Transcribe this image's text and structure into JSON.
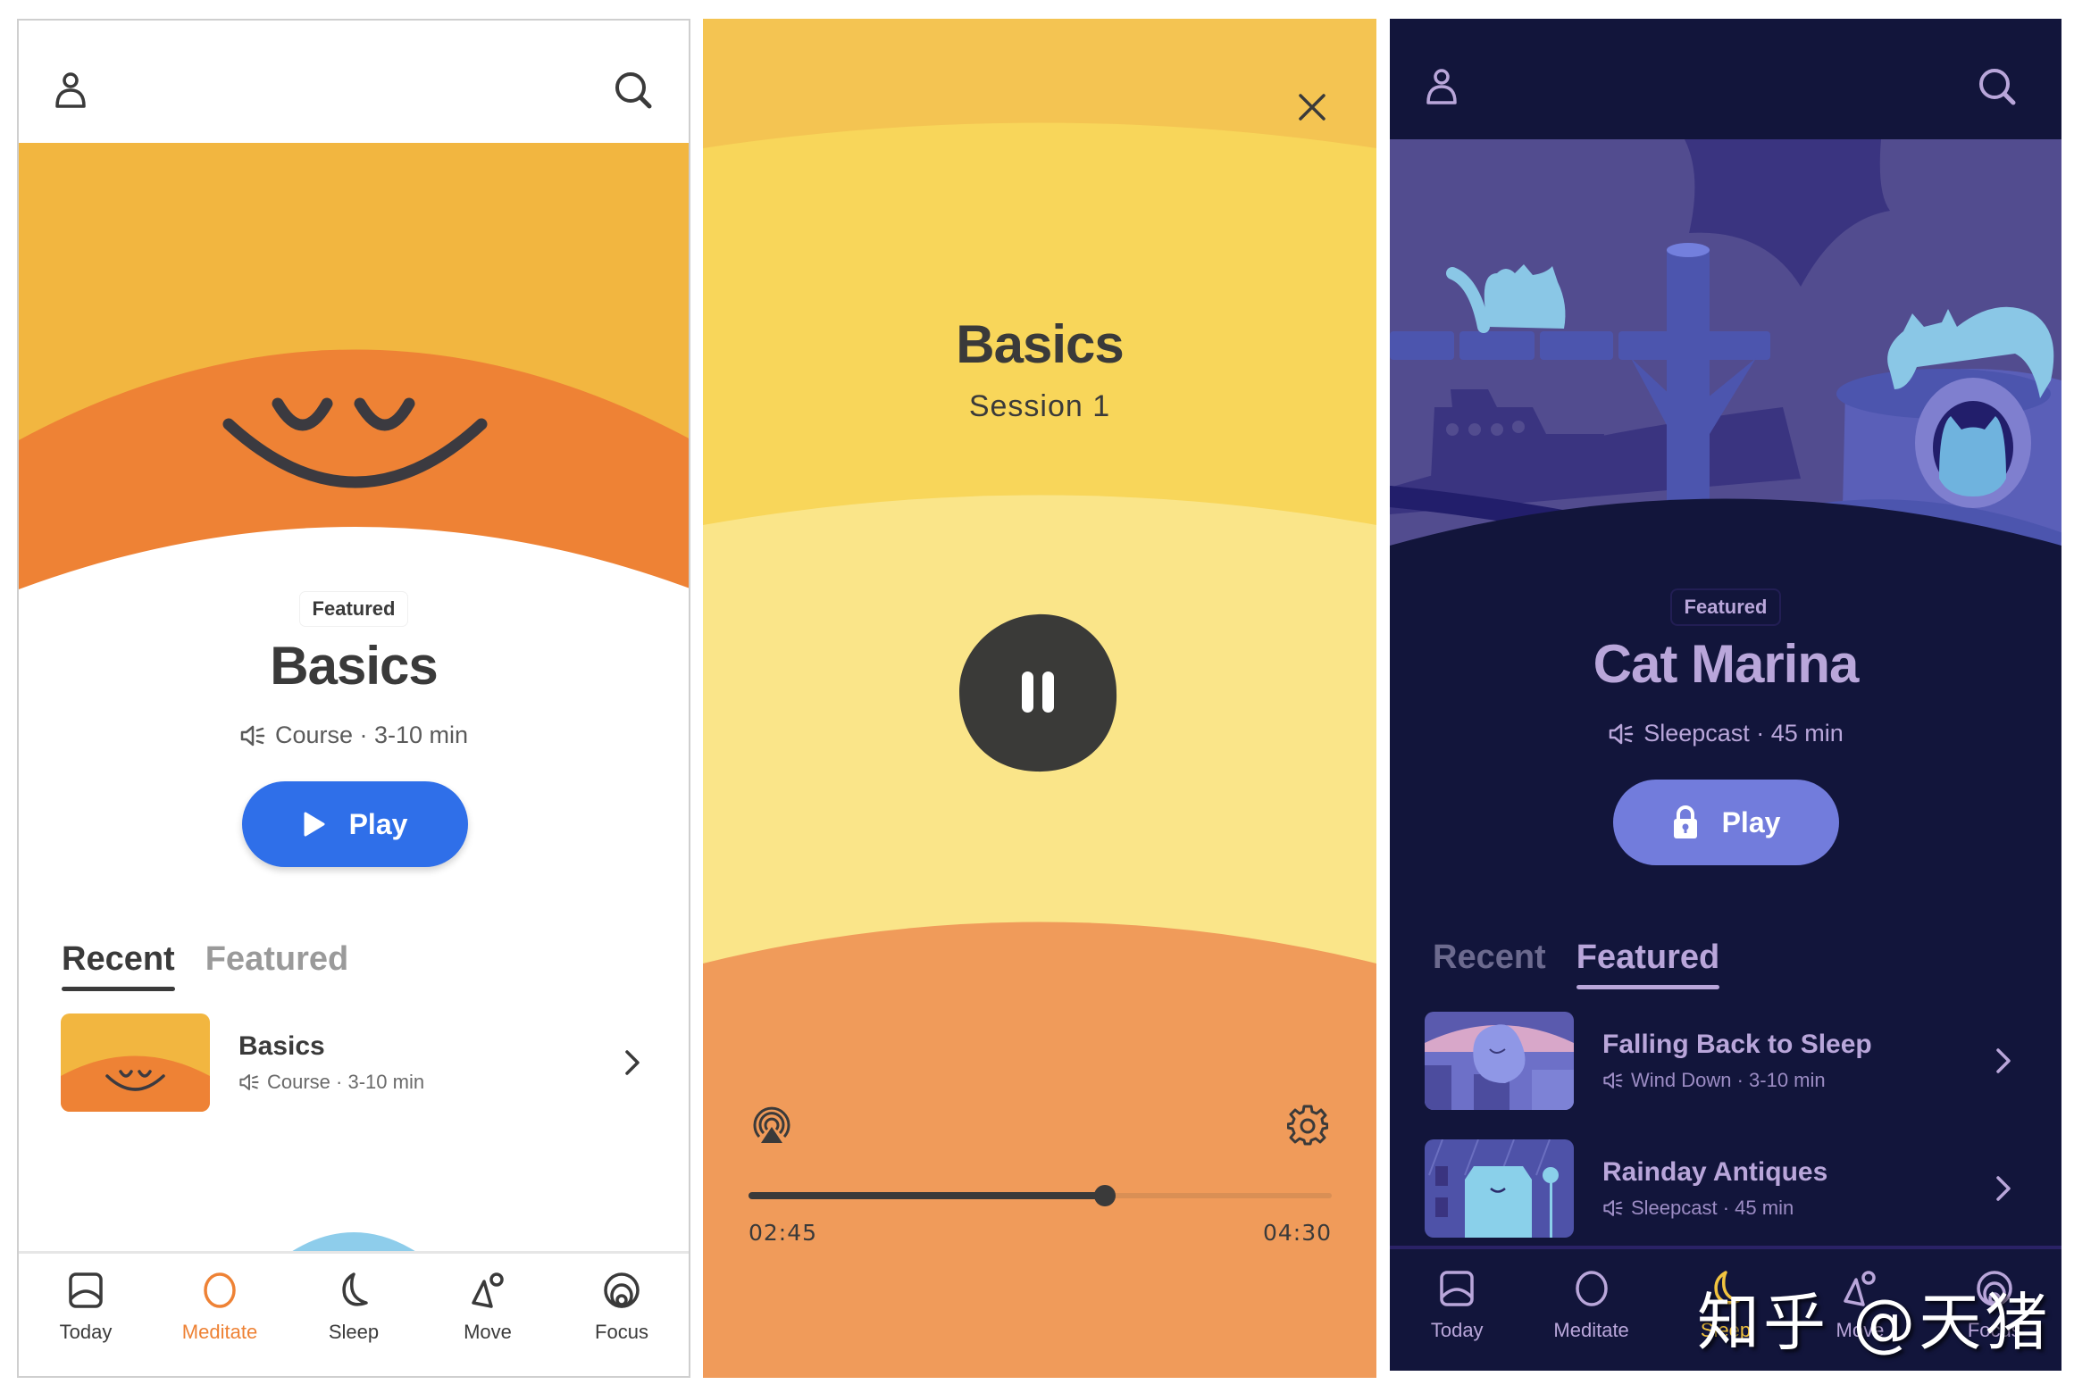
{
  "screens": {
    "meditate": {
      "header": {
        "profile_icon": "person-icon",
        "search_icon": "search-icon"
      },
      "hero": {
        "illustration": "smiling-sun-face"
      },
      "featured_badge": "Featured",
      "title": "Basics",
      "meta": {
        "icon": "speaker-icon",
        "text": "Course · 3-10 min"
      },
      "play_button": {
        "label": "Play",
        "icon": "play-icon"
      },
      "tabs": [
        {
          "label": "Recent",
          "active": true
        },
        {
          "label": "Featured",
          "active": false
        }
      ],
      "list": [
        {
          "title": "Basics",
          "subtitle": "Course · 3-10 min",
          "icon": "speaker-icon"
        }
      ],
      "nav": [
        {
          "label": "Today",
          "icon": "today-icon",
          "active": false
        },
        {
          "label": "Meditate",
          "icon": "meditate-icon",
          "active": true
        },
        {
          "label": "Sleep",
          "icon": "moon-icon",
          "active": false
        },
        {
          "label": "Move",
          "icon": "move-icon",
          "active": false
        },
        {
          "label": "Focus",
          "icon": "focus-icon",
          "active": false
        }
      ],
      "colors": {
        "accent": "#2F6FE9",
        "active_nav": "#EE8235",
        "hero_top": "#F2B640",
        "hero_sun": "#EE8235",
        "text": "#3a3a3a"
      }
    },
    "player": {
      "close_icon": "close-icon",
      "title": "Basics",
      "subtitle": "Session 1",
      "pause_icon": "pause-icon",
      "airplay_icon": "airplay-icon",
      "settings_icon": "gear-icon",
      "elapsed": "02:45",
      "duration": "04:30",
      "progress": 0.611,
      "colors": {
        "band1": "#F4C452",
        "band2": "#F8D65A",
        "band3": "#FAE589",
        "band4": "#F09B5A",
        "control": "#3a3a3a"
      }
    },
    "sleep": {
      "header": {
        "profile_icon": "person-icon",
        "search_icon": "search-icon"
      },
      "hero": {
        "illustration": "cat-marina-harbor"
      },
      "featured_badge": "Featured",
      "title": "Cat Marina",
      "meta": {
        "icon": "speaker-icon",
        "text": "Sleepcast · 45 min"
      },
      "play_button": {
        "label": "Play",
        "icon": "lock-icon"
      },
      "tabs": [
        {
          "label": "Recent",
          "active": false
        },
        {
          "label": "Featured",
          "active": true
        }
      ],
      "list": [
        {
          "title": "Falling Back to Sleep",
          "subtitle": "Wind Down · 3-10 min",
          "icon": "speaker-icon"
        },
        {
          "title": "Rainday Antiques",
          "subtitle": "Sleepcast · 45 min",
          "icon": "speaker-icon"
        }
      ],
      "nav": [
        {
          "label": "Today",
          "icon": "today-icon",
          "active": false
        },
        {
          "label": "Meditate",
          "icon": "meditate-icon",
          "active": false
        },
        {
          "label": "Sleep",
          "icon": "moon-icon",
          "active": true
        },
        {
          "label": "Move",
          "icon": "move-icon",
          "active": false
        },
        {
          "label": "Focus",
          "icon": "focus-icon",
          "active": false
        }
      ],
      "colors": {
        "accent": "#727CDC",
        "background": "#12153B",
        "text": "#B9A6DA",
        "active_nav": "#F2C440"
      }
    }
  },
  "watermark": "知乎 @天猪"
}
